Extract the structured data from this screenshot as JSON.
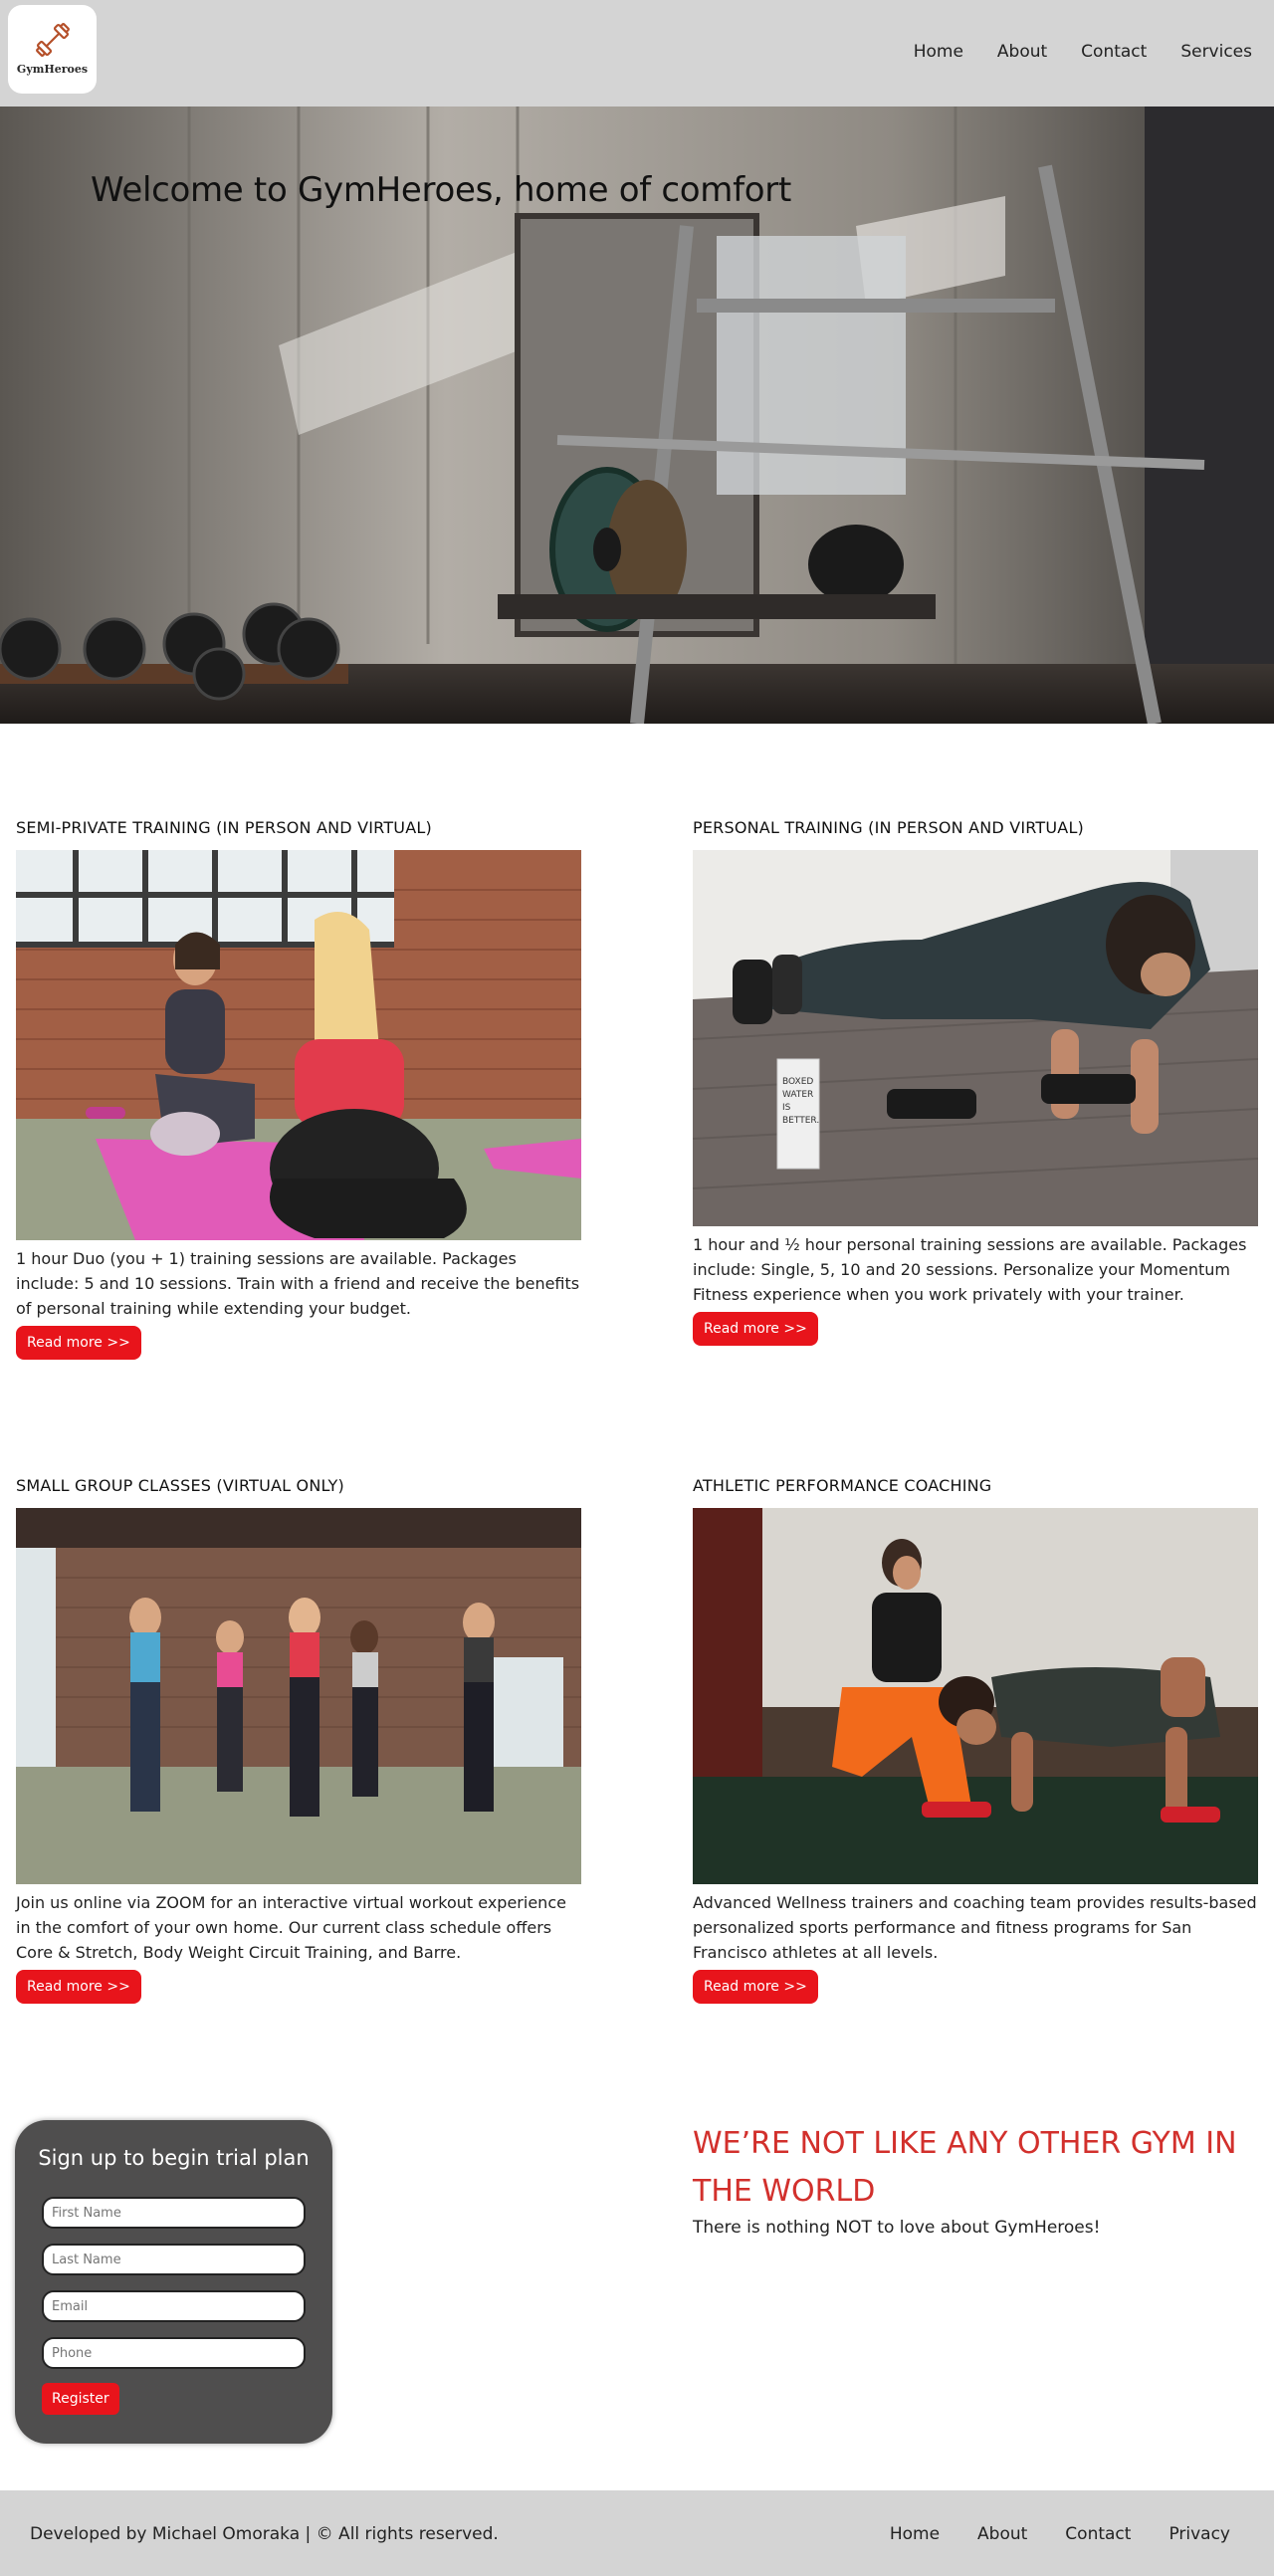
{
  "header": {
    "logo_text": "GymHeroes",
    "nav": [
      "Home",
      "About",
      "Contact",
      "Services"
    ]
  },
  "hero": {
    "title": "Welcome to GymHeroes, home of comfort"
  },
  "cards": [
    {
      "title": "Semi-Private Training (In Person and Virtual)",
      "text": "1 hour Duo (you + 1) training sessions are available. Packages include: 5 and 10 sessions. Train with a friend and receive the benefits of personal training while extending your budget.",
      "button": "Read more >>"
    },
    {
      "title": "Personal Training (In Person and Virtual)",
      "text": "1 hour and ½ hour personal training sessions are available. Packages include: Single, 5, 10 and 20 sessions. Personalize your Momentum Fitness experience when you work privately with your trainer.",
      "button": "Read more >>"
    },
    {
      "title": "Small Group Classes (Virtual Only)",
      "text": "Join us online via ZOOM for an interactive virtual workout experience in the comfort of your own home. Our current class schedule offers Core & Stretch, Body Weight Circuit Training, and Barre.",
      "button": "Read more >>"
    },
    {
      "title": "Athletic Performance Coaching",
      "text": "Advanced Wellness trainers and coaching team provides results-based personalized sports performance and fitness programs for San Francisco athletes at all levels.",
      "button": "Read more >>"
    }
  ],
  "image_labels": {
    "water_box": "BOXED WATER IS BETTER."
  },
  "signup": {
    "title": "Sign up to begin trial plan",
    "first_name_placeholder": "First Name",
    "last_name_placeholder": "Last Name",
    "email_placeholder": "Email",
    "phone_placeholder": "Phone",
    "register": "Register"
  },
  "promo": {
    "heading": "We’re not like any other gym in the world",
    "sub": "There is nothing NOT to love about GymHeroes!"
  },
  "footer": {
    "copyright": "Developed by Michael Omoraka | © All rights reserved.",
    "nav": [
      "Home",
      "About",
      "Contact",
      "Privacy"
    ]
  },
  "colors": {
    "header_bg": "#d4d4d4",
    "accent_red": "#e8141b",
    "promo_red": "#d2302c",
    "signup_bg": "#4f4e4e"
  }
}
